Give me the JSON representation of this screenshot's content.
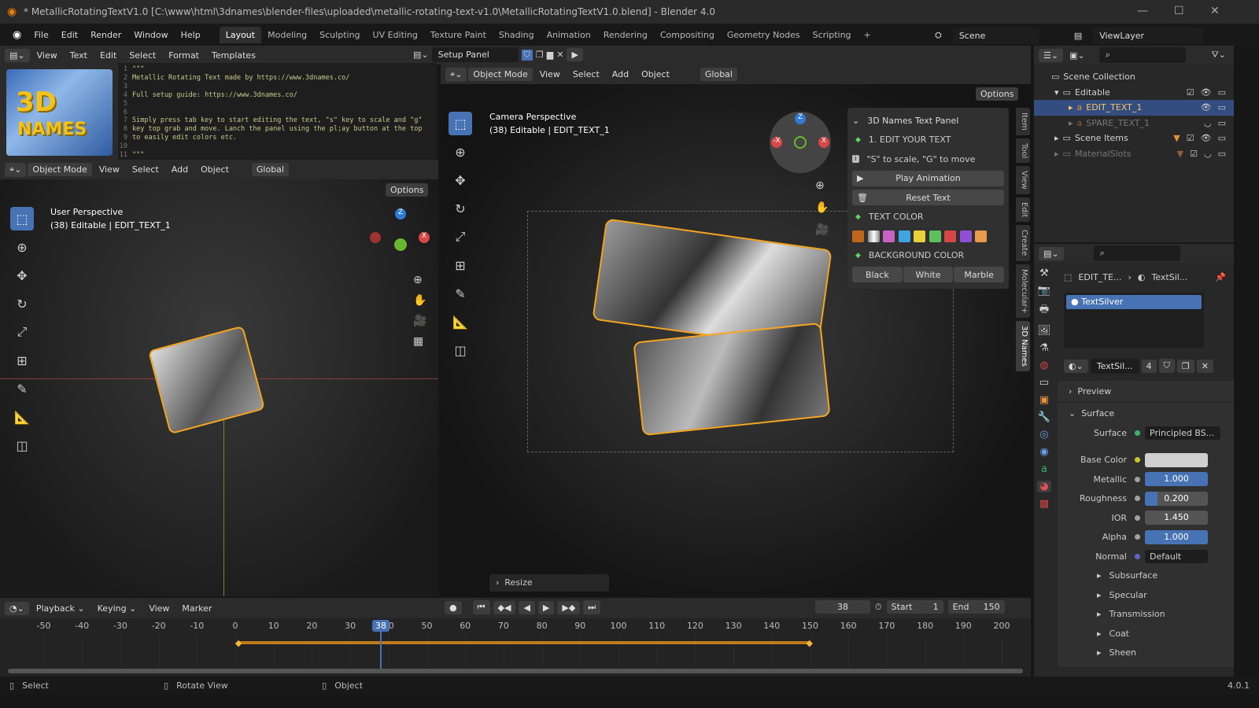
{
  "title_bar": {
    "title": "* MetallicRotatingTextV1.0 [C:\\www\\html\\3dnames\\blender-files\\uploaded\\metallic-rotating-text-v1.0\\MetallicRotatingTextV1.0.blend] - Blender 4.0"
  },
  "menu": [
    "File",
    "Edit",
    "Render",
    "Window",
    "Help"
  ],
  "workspaces": [
    "Layout",
    "Modeling",
    "Sculpting",
    "UV Editing",
    "Texture Paint",
    "Shading",
    "Animation",
    "Rendering",
    "Compositing",
    "Geometry Nodes",
    "Scripting"
  ],
  "active_workspace": "Layout",
  "scene": "Scene",
  "view_layer": "ViewLayer",
  "text_editor": {
    "menus": [
      "View",
      "Text",
      "Edit",
      "Select",
      "Format",
      "Templates"
    ],
    "text_name": "Setup Panel",
    "lines": [
      "\"\"\"",
      "Metallic Rotating Text made by https://www.3dnames.co/",
      "",
      "Full setup guide: https://www.3dnames.co/",
      "",
      "",
      "Simply press tab key to start editing the text, \"s\" key to scale and \"g\"",
      "key top grab and move. Lanch the panel using the pl;ay button at the top",
      "to easily edit colors etc.",
      "",
      "\"\"\""
    ],
    "thumbnail_text": "3D NAMES"
  },
  "left_viewport": {
    "mode": "Object Mode",
    "menus": [
      "View",
      "Select",
      "Add",
      "Object"
    ],
    "orientation": "Global",
    "options": "Options",
    "label": "User Perspective",
    "sublabel": "(38) Editable | EDIT_TEXT_1"
  },
  "camera_viewport": {
    "mode": "Object Mode",
    "menus": [
      "View",
      "Select",
      "Add",
      "Object"
    ],
    "orientation": "Global",
    "options": "Options",
    "label": "Camera Perspective",
    "sublabel": "(38) Editable | EDIT_TEXT_1",
    "last_op": "Resize"
  },
  "n_panel": {
    "title": "3D Names Text Panel",
    "step1": "1. EDIT YOUR TEXT",
    "hint": "\"S\" to scale, \"G\" to move",
    "play": "Play Animation",
    "reset": "Reset Text",
    "text_color": "TEXT COLOR",
    "swatches": [
      "#c0661a",
      "#d8d8d8",
      "#c763c2",
      "#3fa4e0",
      "#e8cf3c",
      "#5cc15c",
      "#d84747",
      "#8f4fd6",
      "#e89a4a"
    ],
    "bg_color": "BACKGROUND COLOR",
    "bg_options": [
      "Black",
      "White",
      "Marble"
    ],
    "tabs": [
      "Item",
      "Tool",
      "View",
      "Edit",
      "Create",
      "Molecular+",
      "3D Names"
    ],
    "active_tab": "3D Names"
  },
  "outliner": {
    "root": "Scene Collection",
    "items": [
      {
        "name": "Editable",
        "type": "collection",
        "depth": 1
      },
      {
        "name": "EDIT_TEXT_1",
        "type": "text",
        "depth": 2,
        "selected": true
      },
      {
        "name": "SPARE_TEXT_1",
        "type": "text",
        "depth": 2,
        "hidden": true
      },
      {
        "name": "Scene Items",
        "type": "collection",
        "depth": 1
      },
      {
        "name": "MaterialSlots",
        "type": "collection",
        "depth": 1,
        "hidden": true
      }
    ]
  },
  "properties": {
    "breadcrumb_object": "EDIT_TE...",
    "breadcrumb_material": "TextSil...",
    "slot": "TextSilver",
    "material_name": "TextSil...",
    "users": "4",
    "sections": {
      "preview": "Preview",
      "surface": "Surface"
    },
    "surface_shader": "Principled BS...",
    "fields": [
      {
        "label": "Surface",
        "value": "Principled BS..."
      },
      {
        "label": "Base Color",
        "value": "",
        "color": "#cfcfcf"
      },
      {
        "label": "Metallic",
        "value": "1.000",
        "fraction": 1.0
      },
      {
        "label": "Roughness",
        "value": "0.200",
        "fraction": 0.2
      },
      {
        "label": "IOR",
        "value": "1.450"
      },
      {
        "label": "Alpha",
        "value": "1.000",
        "fraction": 1.0
      },
      {
        "label": "Normal",
        "value": "Default"
      }
    ],
    "subsections": [
      "Subsurface",
      "Specular",
      "Transmission",
      "Coat",
      "Sheen"
    ]
  },
  "timeline": {
    "menus": [
      "Playback",
      "Keying",
      "View",
      "Marker"
    ],
    "current_frame": "38",
    "start_label": "Start",
    "start": "1",
    "end_label": "End",
    "end": "150",
    "ticks": [
      "-50",
      "-40",
      "-30",
      "-20",
      "-10",
      "0",
      "10",
      "20",
      "30",
      "40",
      "50",
      "60",
      "70",
      "80",
      "90",
      "100",
      "110",
      "120",
      "130",
      "140",
      "150",
      "160",
      "170",
      "180",
      "190",
      "200"
    ],
    "keyframes": [
      1,
      150
    ]
  },
  "status_bar": {
    "items": [
      "Select",
      "Rotate View",
      "Object"
    ],
    "version": "4.0.1"
  },
  "colors": {
    "accent": "#4772b3",
    "orange": "#e87d0d",
    "selection": "#f5a623"
  }
}
